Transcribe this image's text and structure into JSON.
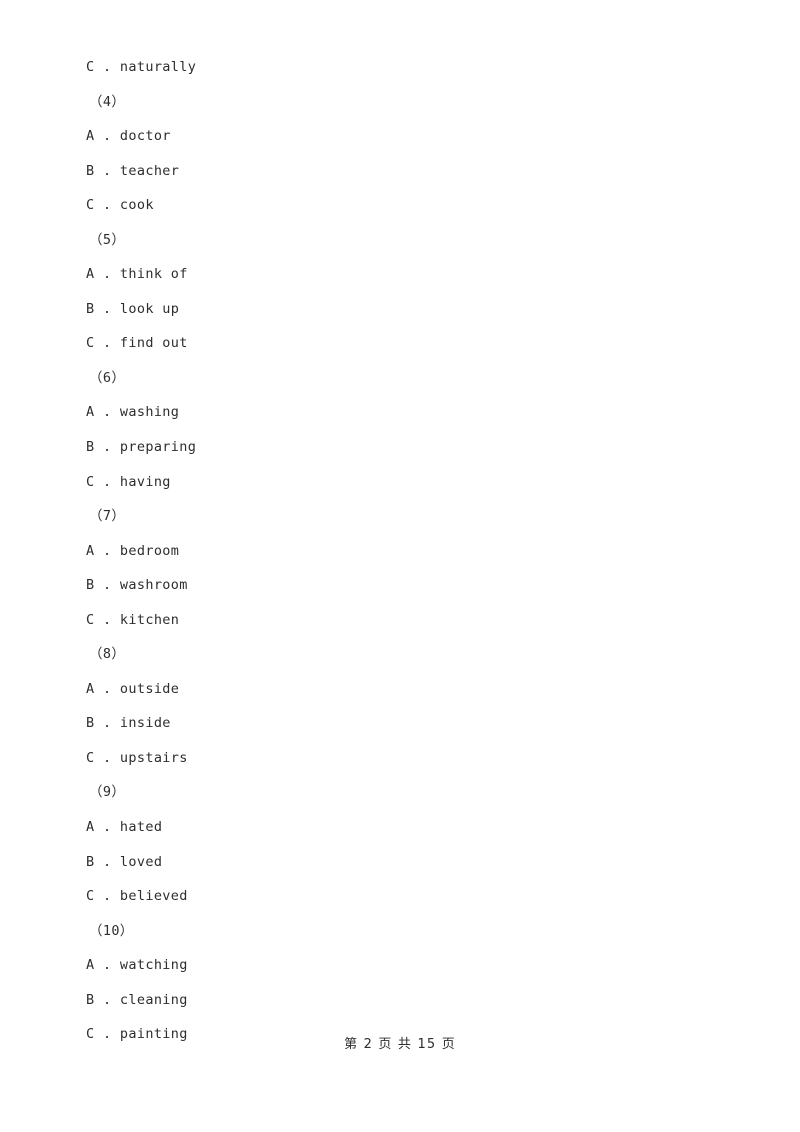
{
  "document": {
    "background_color": "#ffffff",
    "text_color": "#2e2e2e"
  },
  "content": {
    "lines": [
      {
        "kind": "option",
        "letter": "C",
        "separator": " . ",
        "text": "naturally"
      },
      {
        "kind": "question",
        "label": "（4）"
      },
      {
        "kind": "option",
        "letter": "A",
        "separator": " . ",
        "text": "doctor"
      },
      {
        "kind": "option",
        "letter": "B",
        "separator": " . ",
        "text": "teacher"
      },
      {
        "kind": "option",
        "letter": "C",
        "separator": " . ",
        "text": "cook"
      },
      {
        "kind": "question",
        "label": "（5）"
      },
      {
        "kind": "option",
        "letter": "A",
        "separator": " . ",
        "text": "think of"
      },
      {
        "kind": "option",
        "letter": "B",
        "separator": " . ",
        "text": "look up"
      },
      {
        "kind": "option",
        "letter": "C",
        "separator": " . ",
        "text": "find out"
      },
      {
        "kind": "question",
        "label": "（6）"
      },
      {
        "kind": "option",
        "letter": "A",
        "separator": " . ",
        "text": "washing"
      },
      {
        "kind": "option",
        "letter": "B",
        "separator": " . ",
        "text": "preparing"
      },
      {
        "kind": "option",
        "letter": "C",
        "separator": " . ",
        "text": "having"
      },
      {
        "kind": "question",
        "label": "（7）"
      },
      {
        "kind": "option",
        "letter": "A",
        "separator": " . ",
        "text": "bedroom"
      },
      {
        "kind": "option",
        "letter": "B",
        "separator": " . ",
        "text": "washroom"
      },
      {
        "kind": "option",
        "letter": "C",
        "separator": " . ",
        "text": "kitchen"
      },
      {
        "kind": "question",
        "label": "（8）"
      },
      {
        "kind": "option",
        "letter": "A",
        "separator": " . ",
        "text": "outside"
      },
      {
        "kind": "option",
        "letter": "B",
        "separator": " . ",
        "text": "inside"
      },
      {
        "kind": "option",
        "letter": "C",
        "separator": " . ",
        "text": "upstairs"
      },
      {
        "kind": "question",
        "label": "（9）"
      },
      {
        "kind": "option",
        "letter": "A",
        "separator": " . ",
        "text": "hated"
      },
      {
        "kind": "option",
        "letter": "B",
        "separator": " . ",
        "text": "loved"
      },
      {
        "kind": "option",
        "letter": "C",
        "separator": " . ",
        "text": "believed"
      },
      {
        "kind": "question",
        "label": "（10）"
      },
      {
        "kind": "option",
        "letter": "A",
        "separator": " . ",
        "text": "watching"
      },
      {
        "kind": "option",
        "letter": "B",
        "separator": " . ",
        "text": "cleaning"
      },
      {
        "kind": "option",
        "letter": "C",
        "separator": " . ",
        "text": "painting"
      }
    ]
  },
  "footer": {
    "page_indicator": "第 2 页 共 15 页",
    "current_page": "2",
    "total_pages": "15"
  }
}
